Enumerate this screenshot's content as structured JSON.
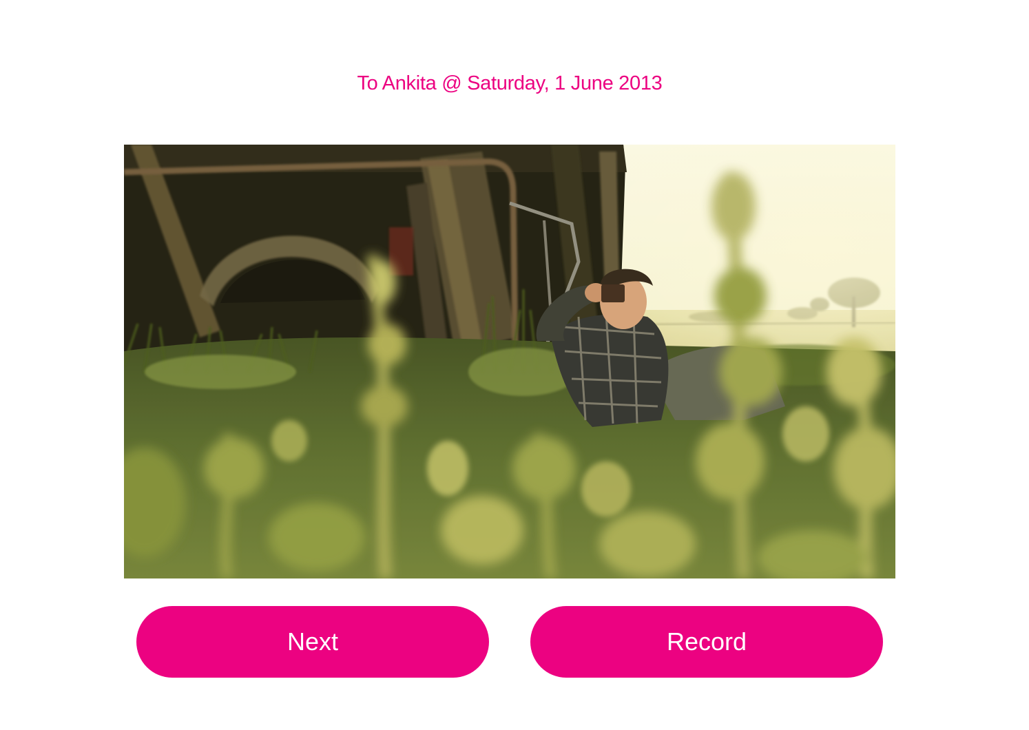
{
  "header": {
    "dedication": "To Ankita @ Saturday, 1 June 2013"
  },
  "media": {
    "image_subject": "young man in plaid shirt sitting in grass beside an old shed holding a phone"
  },
  "actions": {
    "next_label": "Next",
    "record_label": "Record"
  },
  "colors": {
    "accent": "#ec0281",
    "button_text": "#ffffff",
    "background": "#ffffff"
  }
}
